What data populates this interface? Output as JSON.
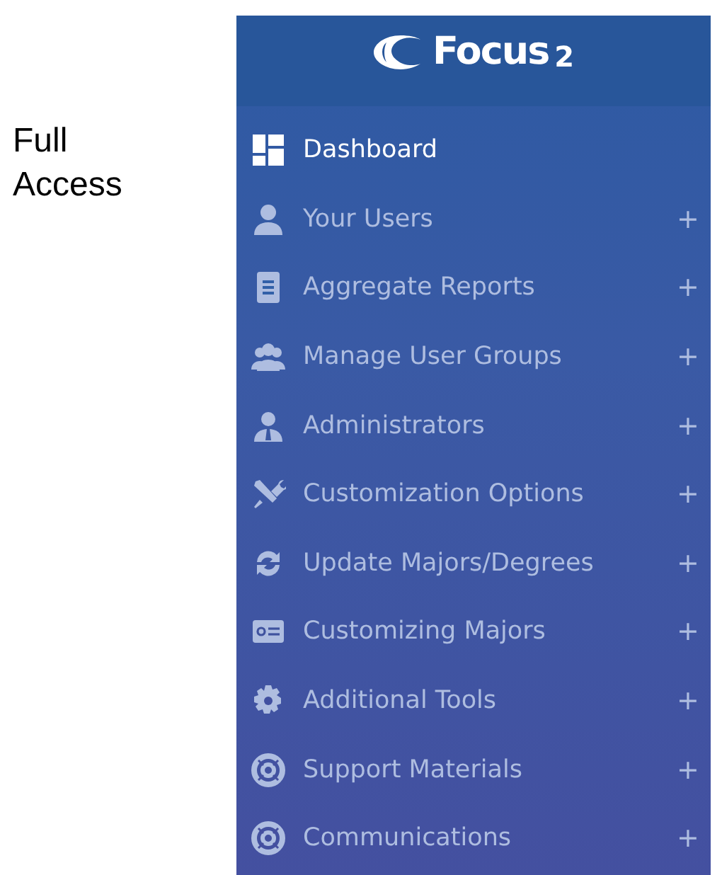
{
  "side_label": "Full Access",
  "logo": {
    "name": "Focus",
    "suffix": "2"
  },
  "menu": [
    {
      "label": "Dashboard",
      "selected": true
    },
    {
      "label": "Your Users",
      "selected": false,
      "toggle": "+"
    },
    {
      "label": "Aggregate Reports",
      "selected": false,
      "toggle": "+"
    },
    {
      "label": "Manage User Groups",
      "selected": false,
      "toggle": "+"
    },
    {
      "label": "Administrators",
      "selected": false,
      "toggle": "+"
    },
    {
      "label": "Customization Options",
      "selected": false,
      "toggle": "+"
    },
    {
      "label": "Update Majors/Degrees",
      "selected": false,
      "toggle": "+"
    },
    {
      "label": "Customizing Majors",
      "selected": false,
      "toggle": "+"
    },
    {
      "label": "Additional Tools",
      "selected": false,
      "toggle": "+"
    },
    {
      "label": "Support Materials",
      "selected": false,
      "toggle": "+"
    },
    {
      "label": "Communications",
      "selected": false,
      "toggle": "+"
    }
  ]
}
